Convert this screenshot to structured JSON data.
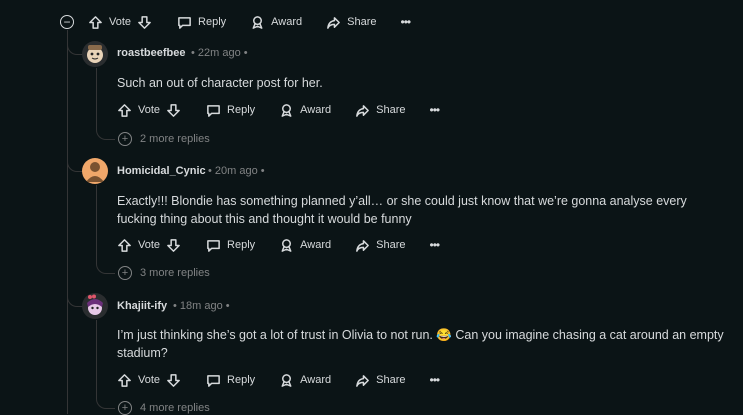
{
  "top_actions": {
    "vote_label": "Vote",
    "reply_label": "Reply",
    "award_label": "Award",
    "share_label": "Share",
    "more_label": "•••",
    "collapse_label": "−"
  },
  "comments": [
    {
      "author": "roastbeefbee",
      "time": "22m ago",
      "dot": "•",
      "text": "Such an out of character post for her.",
      "vote_label": "Vote",
      "reply_label": "Reply",
      "award_label": "Award",
      "share_label": "Share",
      "more_label": "•••",
      "more_replies": "2 more replies"
    },
    {
      "author": "Homicidal_Cynic",
      "time": "20m ago",
      "dot": "•",
      "text": "Exactly!!! Blondie has something planned y’all… or she could just know that we’re gonna analyse every fucking thing about this and thought it would be funny",
      "vote_label": "Vote",
      "reply_label": "Reply",
      "award_label": "Award",
      "share_label": "Share",
      "more_label": "•••",
      "more_replies": "3 more replies"
    },
    {
      "author": "Khajiit-ify",
      "time": "18m ago",
      "dot": "•",
      "text": "I’m just thinking she’s got a lot of trust in Olivia to not run. 😂 Can you imagine chasing a cat around an empty stadium?",
      "vote_label": "Vote",
      "reply_label": "Reply",
      "award_label": "Award",
      "share_label": "Share",
      "more_label": "•••",
      "more_replies": "4 more replies"
    }
  ],
  "plus_symbol": "+",
  "colors": {
    "background": "#0b1416",
    "text": "#d7dadc",
    "muted": "#818384",
    "thread_line": "#343536"
  }
}
